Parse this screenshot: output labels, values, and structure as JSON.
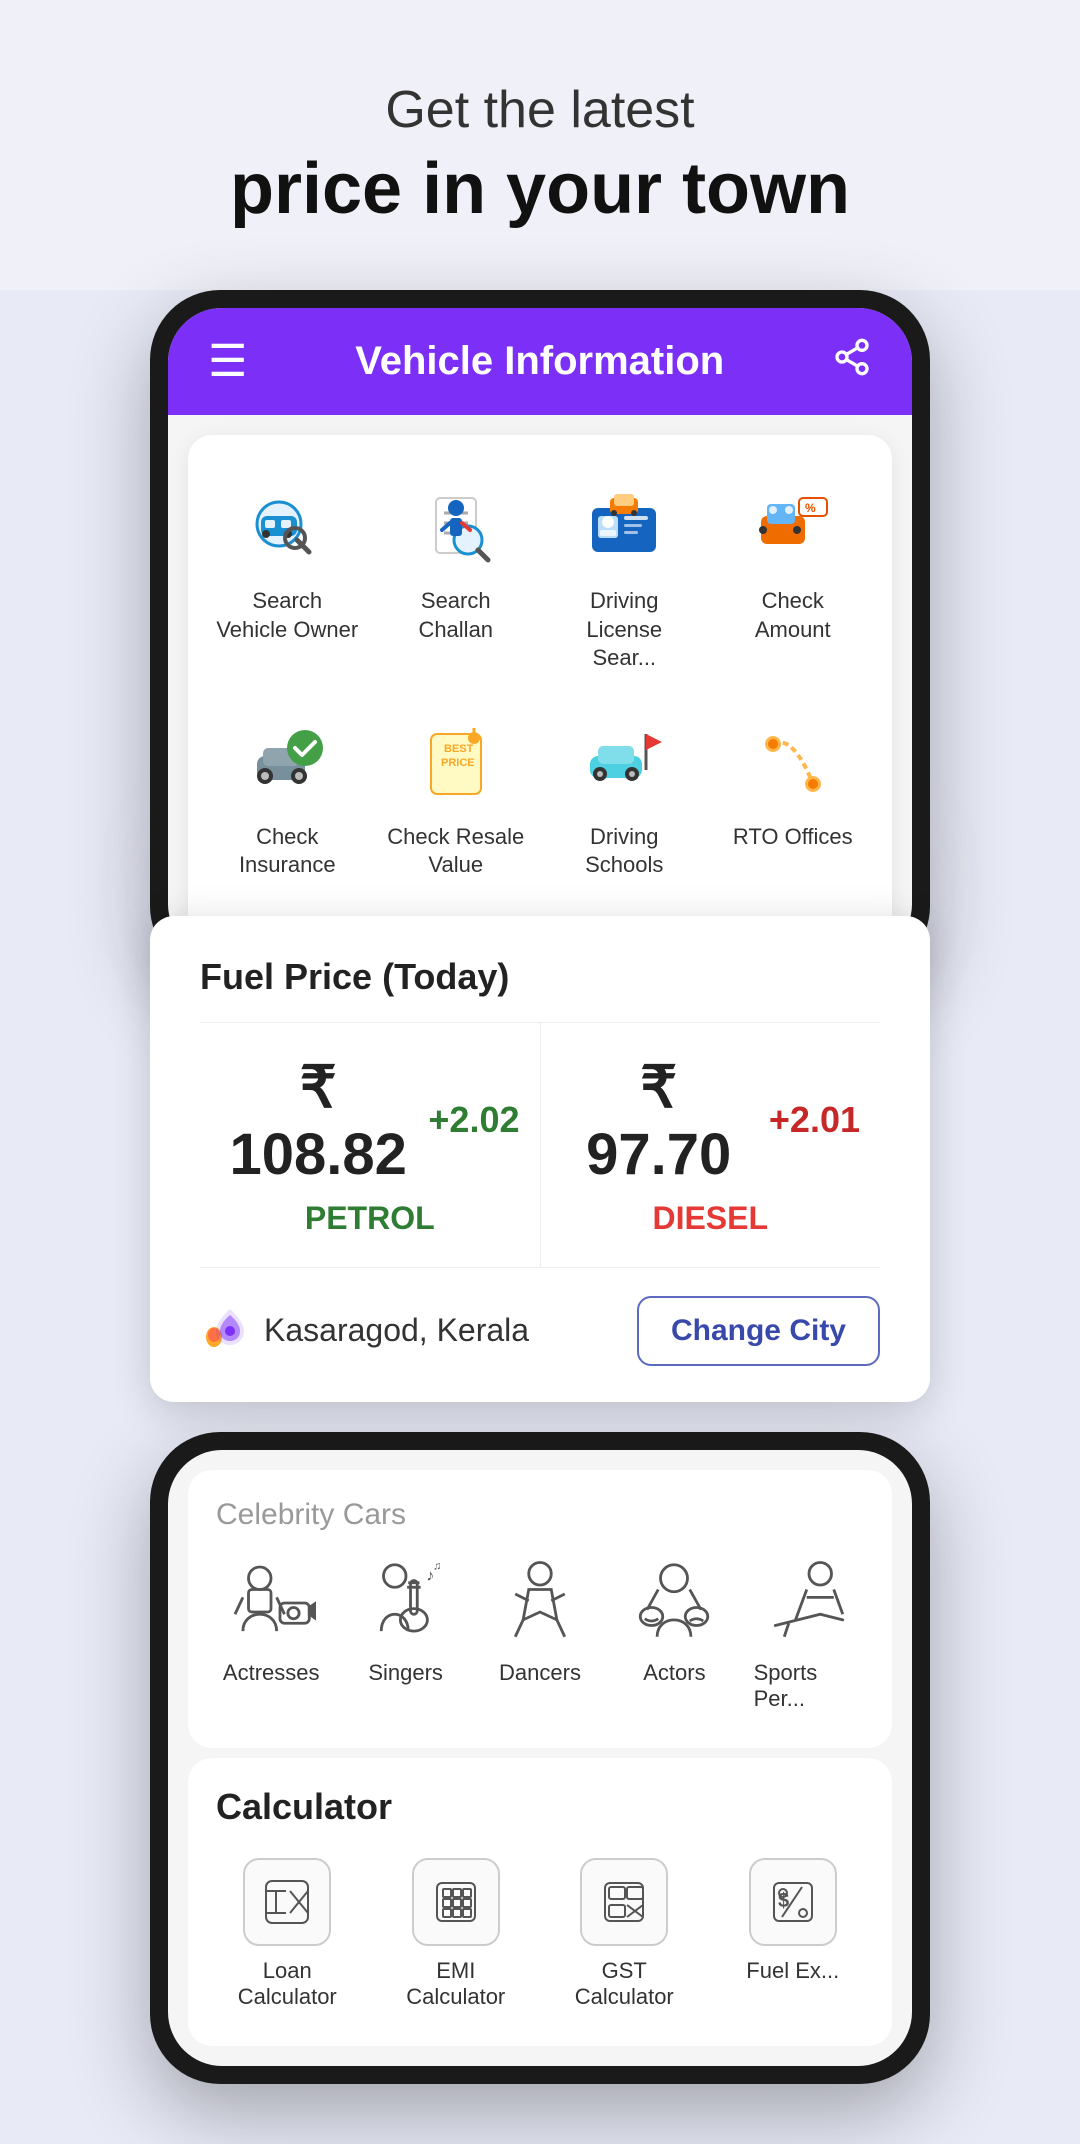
{
  "hero": {
    "subtitle": "Get the latest",
    "title": "price in your town"
  },
  "app": {
    "title": "Vehicle Information",
    "hamburger_icon": "☰",
    "share_icon": "⎘"
  },
  "grid_row1": [
    {
      "id": "search-vehicle-owner",
      "label": "Search Vehicle Owner",
      "color": "#1a8fd1"
    },
    {
      "id": "search-challan",
      "label": "Search Challan",
      "color": "#e53935"
    },
    {
      "id": "driving-license-search",
      "label": "Driving License Sear...",
      "color": "#1565c0"
    },
    {
      "id": "check-amount",
      "label": "Check Amount",
      "color": "#e65100"
    }
  ],
  "grid_row2": [
    {
      "id": "check-insurance",
      "label": "Check Insurance",
      "color": "#2e7d32"
    },
    {
      "id": "check-resale-value",
      "label": "Check Resale Value",
      "color": "#f9a825"
    },
    {
      "id": "driving-schools",
      "label": "Driving Schools",
      "color": "#00838f"
    },
    {
      "id": "rto-offices",
      "label": "RTO Offices",
      "color": "#f57c00"
    }
  ],
  "fuel": {
    "title": "Fuel Price (Today)",
    "petrol_price": "₹ 108.82",
    "petrol_change": "+2.02",
    "petrol_label": "PETROL",
    "diesel_price": "₹ 97.70",
    "diesel_change": "+2.01",
    "diesel_label": "DIESEL",
    "location": "Kasaragod, Kerala",
    "change_city_label": "Change City"
  },
  "celebrity": {
    "title": "Celebrity Cars",
    "items": [
      {
        "id": "actresses",
        "label": "Actresses"
      },
      {
        "id": "singers",
        "label": "Singers"
      },
      {
        "id": "dancers",
        "label": "Dancers"
      },
      {
        "id": "actors",
        "label": "Actors"
      },
      {
        "id": "sports-persons",
        "label": "Sports Per..."
      }
    ]
  },
  "calculator": {
    "title": "Calculator",
    "items": [
      {
        "id": "loan-calculator",
        "label": "Loan Calculator"
      },
      {
        "id": "emi-calculator",
        "label": "EMI Calculator"
      },
      {
        "id": "gst-calculator",
        "label": "GST Calculator"
      },
      {
        "id": "fuel-ex",
        "label": "Fuel Ex..."
      }
    ]
  }
}
